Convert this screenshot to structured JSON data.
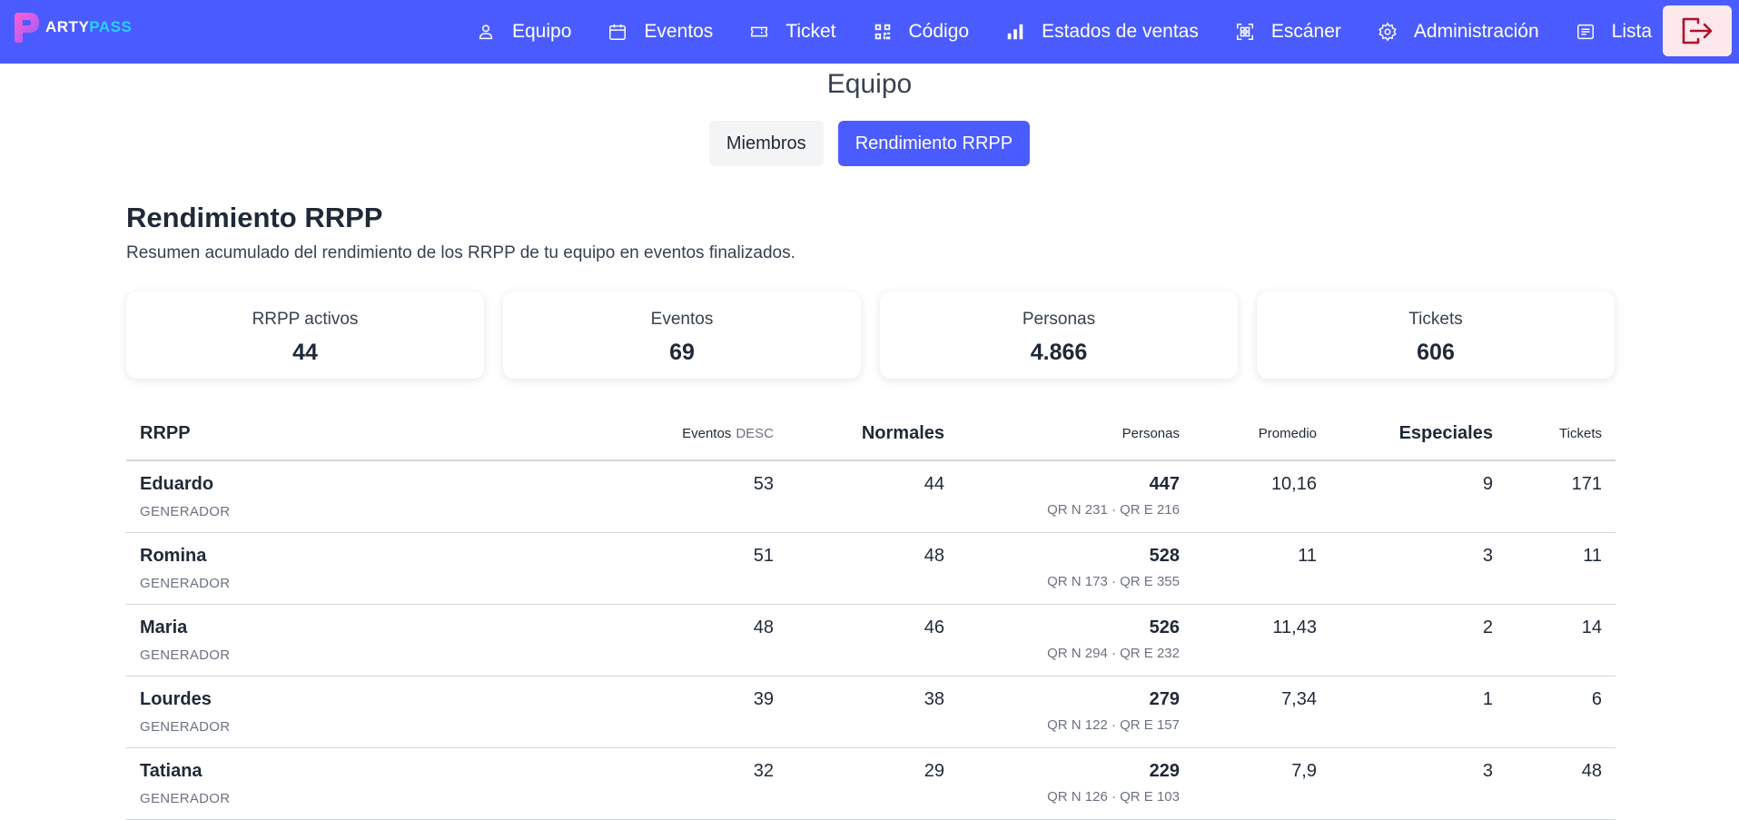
{
  "brand": {
    "logo_a": "ARTY",
    "logo_b": "PASS",
    "accent": "#4a5cff"
  },
  "nav": [
    {
      "label": "Equipo",
      "icon": "user-icon"
    },
    {
      "label": "Eventos",
      "icon": "calendar-icon"
    },
    {
      "label": "Ticket",
      "icon": "ticket-icon"
    },
    {
      "label": "Código",
      "icon": "qr-code-icon"
    },
    {
      "label": "Estados de ventas",
      "icon": "bar-chart-icon"
    },
    {
      "label": "Escáner",
      "icon": "scanner-icon"
    },
    {
      "label": "Administración",
      "icon": "gear-icon"
    },
    {
      "label": "Lista",
      "icon": "list-icon"
    }
  ],
  "page": {
    "title": "Equipo"
  },
  "tabs": {
    "members": "Miembros",
    "performance": "Rendimiento RRPP"
  },
  "section": {
    "title": "Rendimiento RRPP",
    "subtitle": "Resumen acumulado del rendimiento de los RRPP de tu equipo en eventos finalizados."
  },
  "stats": [
    {
      "label": "RRPP activos",
      "value": "44"
    },
    {
      "label": "Eventos",
      "value": "69"
    },
    {
      "label": "Personas",
      "value": "4.866"
    },
    {
      "label": "Tickets",
      "value": "606"
    }
  ],
  "table": {
    "headers": {
      "rrpp": "RRPP",
      "eventos": "Eventos",
      "eventos_sort": "DESC",
      "normales": "Normales",
      "personas": "Personas",
      "promedio": "Promedio",
      "especiales": "Especiales",
      "tickets": "Tickets"
    },
    "rows": [
      {
        "name": "Eduardo",
        "role": "GENERADOR",
        "eventos": "53",
        "normales": "44",
        "personas": "447",
        "qr": "QR N 231 · QR E 216",
        "promedio": "10,16",
        "especiales": "9",
        "tickets": "171"
      },
      {
        "name": "Romina",
        "role": "GENERADOR",
        "eventos": "51",
        "normales": "48",
        "personas": "528",
        "qr": "QR N 173 · QR E 355",
        "promedio": "11",
        "especiales": "3",
        "tickets": "11"
      },
      {
        "name": "Maria",
        "role": "GENERADOR",
        "eventos": "48",
        "normales": "46",
        "personas": "526",
        "qr": "QR N 294 · QR E 232",
        "promedio": "11,43",
        "especiales": "2",
        "tickets": "14"
      },
      {
        "name": "Lourdes",
        "role": "GENERADOR",
        "eventos": "39",
        "normales": "38",
        "personas": "279",
        "qr": "QR N 122 · QR E 157",
        "promedio": "7,34",
        "especiales": "1",
        "tickets": "6"
      },
      {
        "name": "Tatiana",
        "role": "GENERADOR",
        "eventos": "32",
        "normales": "29",
        "personas": "229",
        "qr": "QR N 126 · QR E 103",
        "promedio": "7,9",
        "especiales": "3",
        "tickets": "48"
      }
    ]
  }
}
